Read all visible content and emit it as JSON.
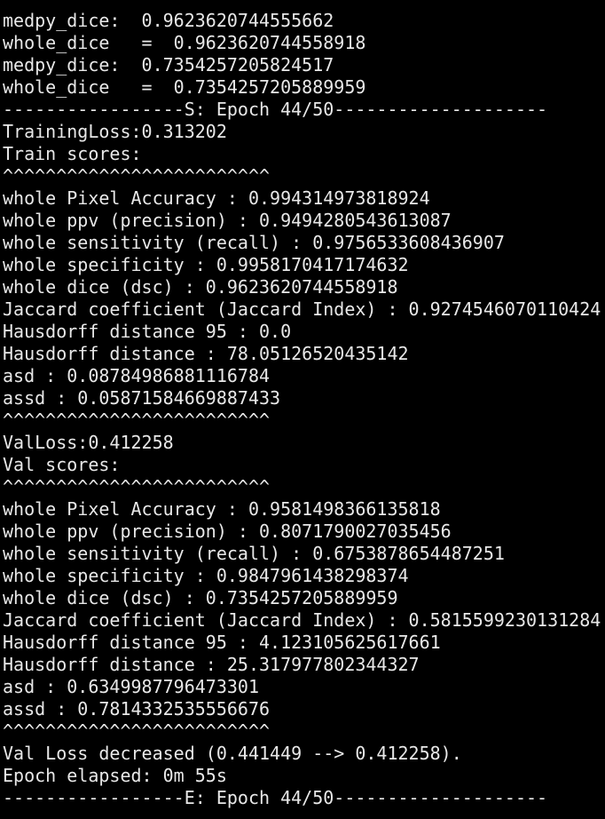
{
  "terminal": {
    "colors": {
      "background": "#000000",
      "text": "#e8e8e8"
    },
    "lines": [
      "medpy_dice:  0.9623620744555662",
      "whole_dice   =  0.9623620744558918",
      "medpy_dice:  0.7354257205824517",
      "whole_dice   =  0.7354257205889959",
      "-----------------S: Epoch 44/50--------------------",
      "TrainingLoss:0.313202",
      "Train scores:",
      "^^^^^^^^^^^^^^^^^^^^^^^^^",
      "whole Pixel Accuracy : 0.994314973818924",
      "whole ppv (precision) : 0.9494280543613087",
      "whole sensitivity (recall) : 0.9756533608436907",
      "whole specificity : 0.9958170417174632",
      "whole dice (dsc) : 0.9623620744558918",
      "Jaccard coefficient (Jaccard Index) : 0.9274546070110424",
      "Hausdorff distance 95 : 0.0",
      "Hausdorff distance : 78.05126520435142",
      "asd : 0.08784986881116784",
      "assd : 0.05871584669887433",
      "^^^^^^^^^^^^^^^^^^^^^^^^^",
      "ValLoss:0.412258",
      "Val scores:",
      "^^^^^^^^^^^^^^^^^^^^^^^^^",
      "whole Pixel Accuracy : 0.9581498366135818",
      "whole ppv (precision) : 0.8071790027035456",
      "whole sensitivity (recall) : 0.6753878654487251",
      "whole specificity : 0.9847961438298374",
      "whole dice (dsc) : 0.7354257205889959",
      "Jaccard coefficient (Jaccard Index) : 0.5815599230131284",
      "Hausdorff distance 95 : 4.123105625617661",
      "Hausdorff distance : 25.317977802344327",
      "asd : 0.6349987796473301",
      "assd : 0.7814332535556676",
      "^^^^^^^^^^^^^^^^^^^^^^^^^",
      "Val Loss decreased (0.441449 --> 0.412258).",
      "Epoch elapsed: 0m 55s",
      "-----------------E: Epoch 44/50--------------------"
    ]
  }
}
